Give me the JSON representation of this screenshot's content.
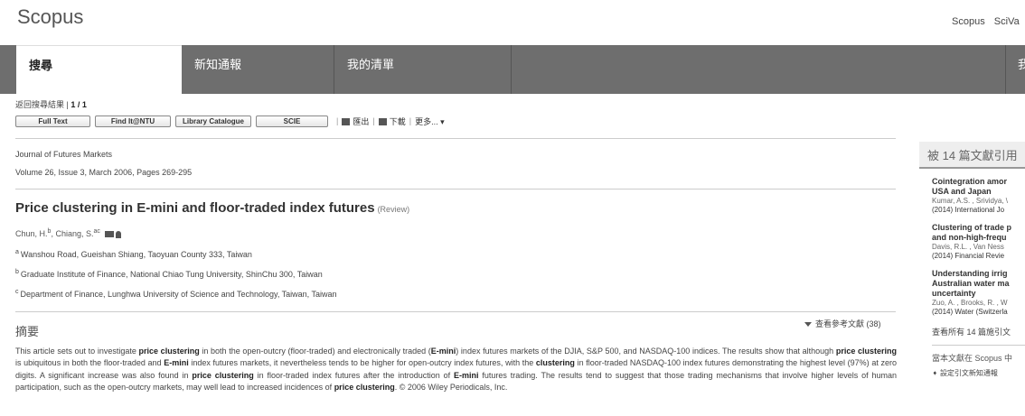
{
  "header": {
    "logo": "Scopus",
    "top_links": [
      "Scopus",
      "SciVa"
    ]
  },
  "nav": {
    "tabs": [
      {
        "label": "搜尋",
        "active": true
      },
      {
        "label": "新知通報",
        "active": false
      },
      {
        "label": "我的清單",
        "active": false
      },
      {
        "label": "",
        "active": false
      },
      {
        "label": "我",
        "active": false
      }
    ]
  },
  "breadcrumb": {
    "back": "返回搜尋結果",
    "sep": "|",
    "position": "1 / 1"
  },
  "toolbar": {
    "full_text": "Full Text",
    "find_it": "Find It@NTU",
    "library": "Library Catalogue",
    "scie": "SCIE",
    "export": "匯出",
    "download": "下載",
    "more": "更多..."
  },
  "article": {
    "journal": "Journal of Futures Markets",
    "volume": "Volume 26, Issue 3, March 2006, Pages 269-295",
    "title": "Price clustering in E-mini and floor-traded index futures",
    "type": "(Review)",
    "authors": [
      {
        "name": "Chun, H.",
        "sup": "b"
      },
      {
        "name": "Chiang, S.",
        "sup": "ac"
      }
    ],
    "affiliations": [
      {
        "sup": "a",
        "text": "Wanshou Road, Gueishan Shiang, Taoyuan County 333, Taiwan"
      },
      {
        "sup": "b",
        "text": "Graduate Institute of Finance, National Chiao Tung University, ShinChu 300, Taiwan"
      },
      {
        "sup": "c",
        "text": "Department of Finance, Lunghwa University of Science and Technology, Taiwan, Taiwan"
      }
    ],
    "abstract_heading": "摘要",
    "refs_link": "查看參考文獻 (38)",
    "abstract": "This article sets out to investigate price clustering in both the open-outcry (floor-traded) and electronically traded (E-mini) index futures markets of the DJIA, S&P 500, and NASDAQ-100 indices. The results show that although price clustering is ubiquitous in both the floor-traded and E-mini index futures markets, it nevertheless tends to be higher for open-outcry index futures, with the clustering in floor-traded NASDAQ-100 index futures demonstrating the highest level (97%) at zero digits. A significant increase was also found in price clustering in floor-traded index futures after the introduction of E-mini futures trading. The results tend to suggest that those trading mechanisms that involve higher levels of human participation, such as the open-outcry markets, may well lead to increased incidences of price clustering. © 2006 Wiley Periodicals, Inc."
  },
  "sidebar": {
    "heading": "被 14 篇文獻引用",
    "citations": [
      {
        "title1": "Cointegration amor",
        "title2": "USA and Japan",
        "title3": "",
        "authors": "Kumar, A.S. , Srividya, \\",
        "journal": "(2014) International Jo"
      },
      {
        "title1": "Clustering of trade p",
        "title2": "and non-high-frequ",
        "title3": "",
        "authors": "Davis, R.L. , Van Ness",
        "journal": "(2014) Financial Revie"
      },
      {
        "title1": "Understanding irrig",
        "title2": "Australian water ma",
        "title3": "uncertainty",
        "authors": "Zuo, A. , Brooks, R. , W",
        "journal": "(2014) Water (Switzerla"
      }
    ],
    "view_all": "查看所有 14 篇施引文",
    "note": "當本文獻在 Scopus 中",
    "alert": "設定引文新知通報"
  }
}
